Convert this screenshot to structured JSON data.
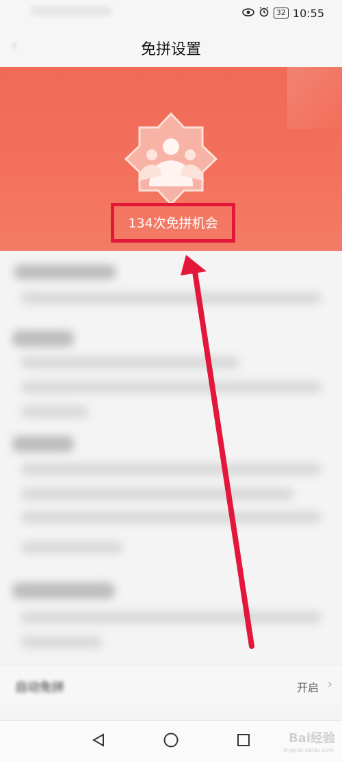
{
  "status_bar": {
    "battery": "32",
    "time": "10:55"
  },
  "header": {
    "title": "免拼设置"
  },
  "banner": {
    "chances_text": "134次免拼机会"
  },
  "settings_row": {
    "label": "自动免拼",
    "value": "开启"
  },
  "watermark": {
    "text": "Bai经验",
    "sub": "jingyan.baidu.com"
  },
  "colors": {
    "banner": "#f06b57",
    "highlight_box": "#e3173a",
    "arrow": "#e3173a"
  },
  "icons": [
    "eye-icon",
    "alarm-icon",
    "battery-icon",
    "back-arrow-icon",
    "group-badge-icon",
    "chevron-right-icon",
    "nav-back-icon",
    "nav-home-icon",
    "nav-recents-icon"
  ]
}
